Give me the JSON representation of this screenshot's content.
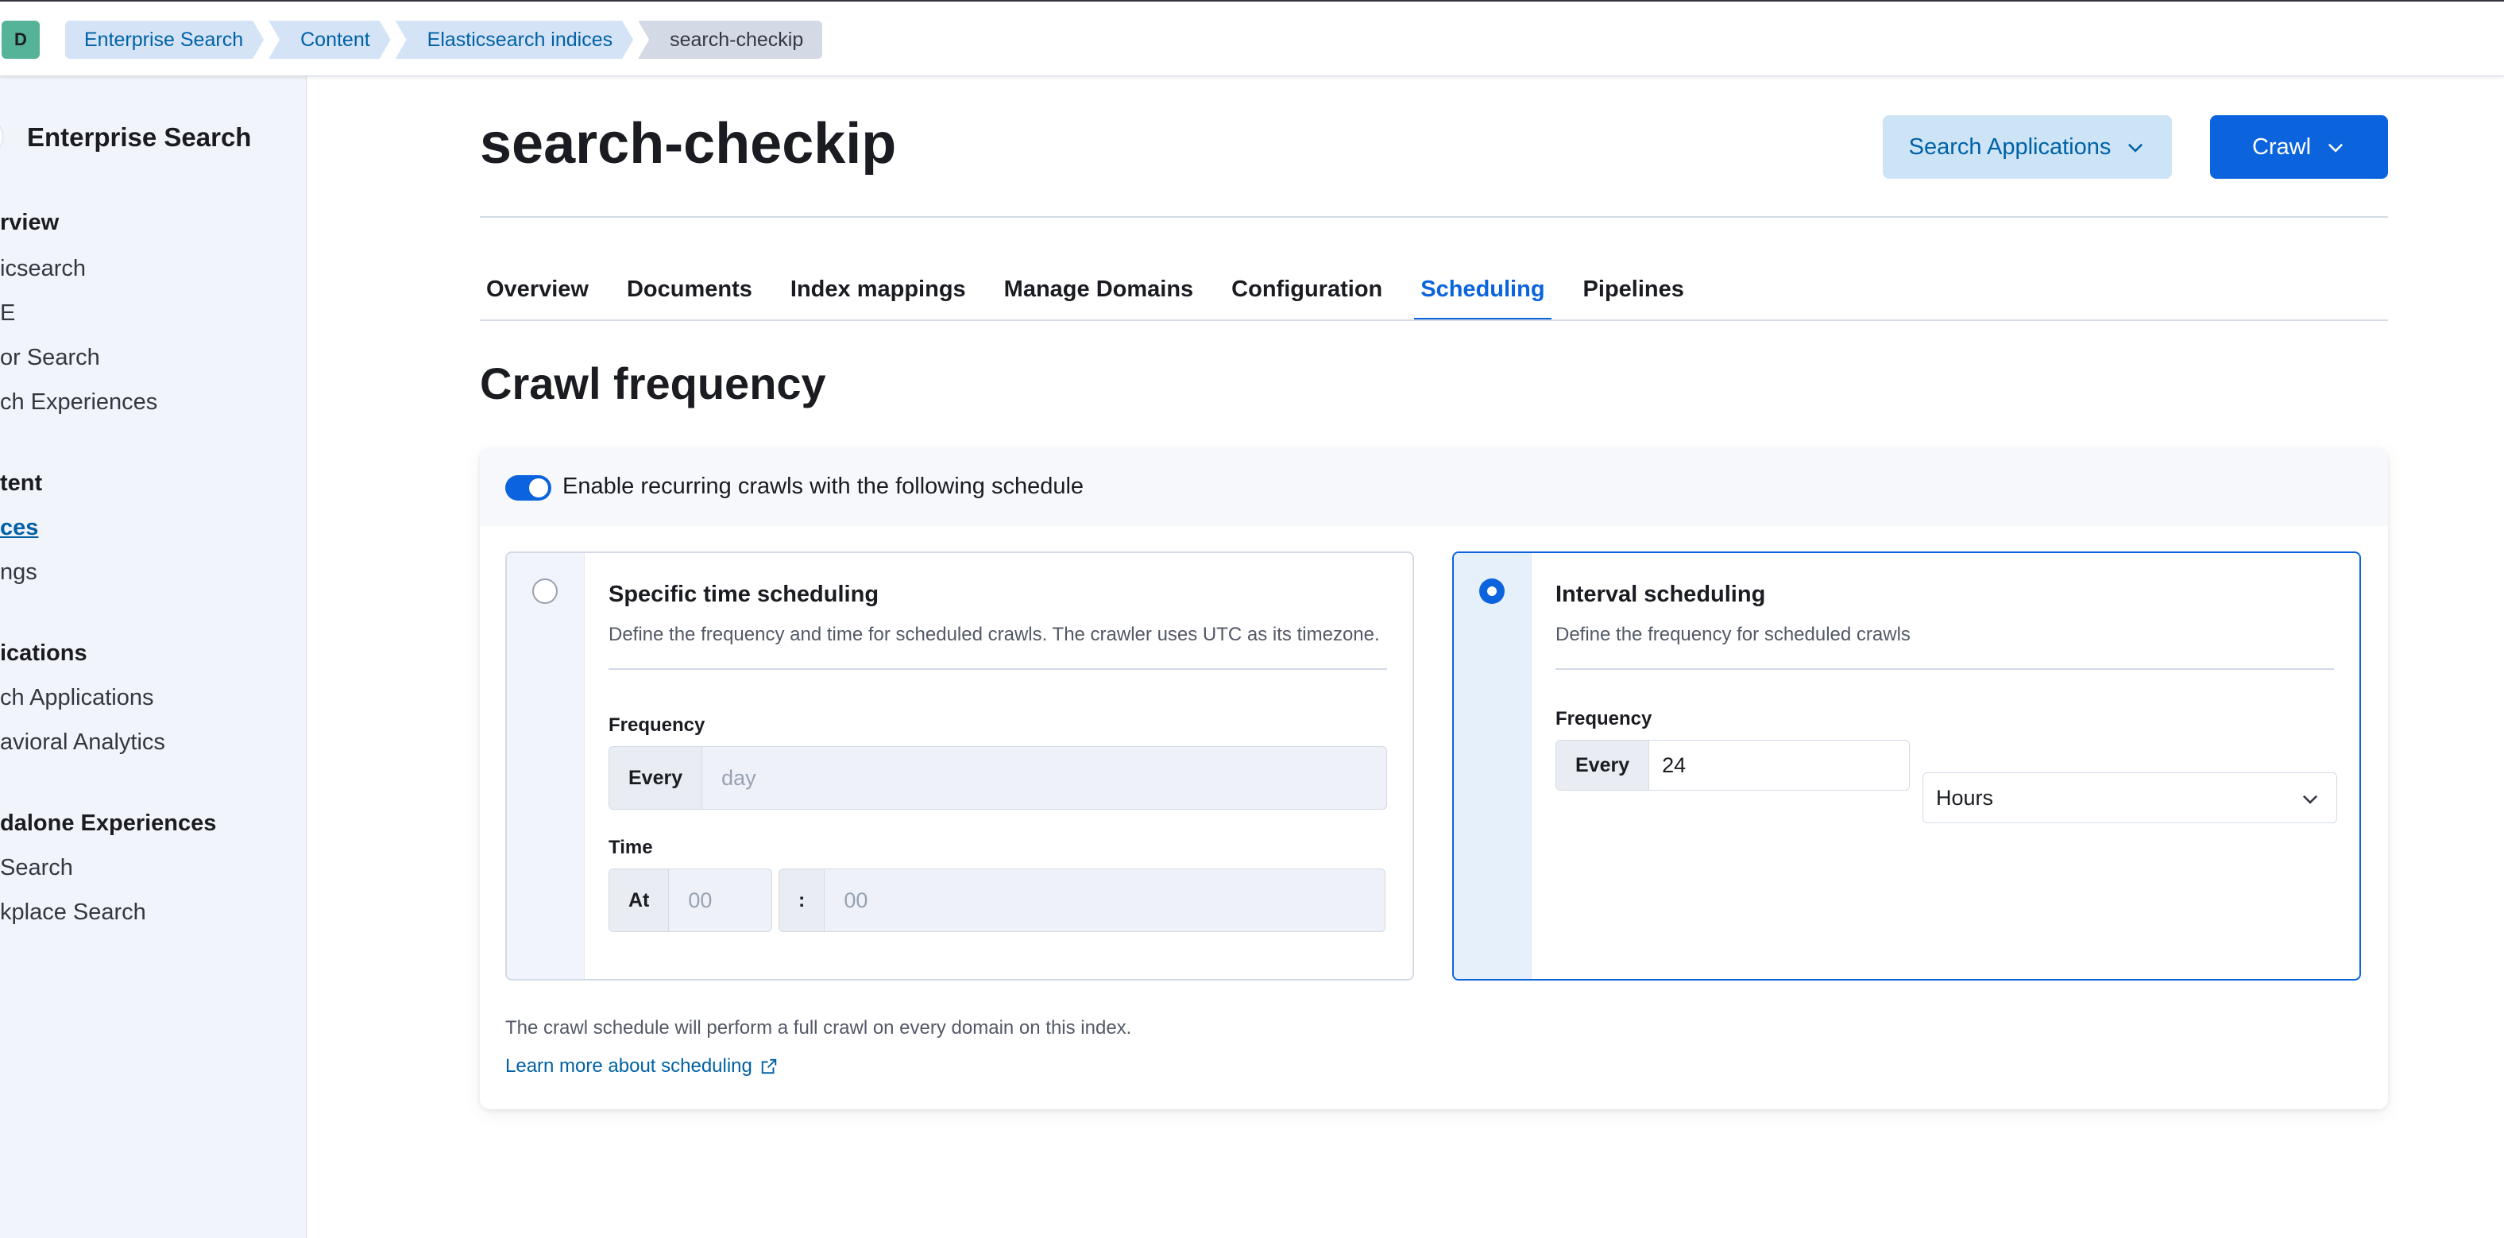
{
  "header": {
    "avatar_letter": "D",
    "breadcrumbs": [
      "Enterprise Search",
      "Content",
      "Elasticsearch indices",
      "search-checkip"
    ]
  },
  "sidebar": {
    "title": "Enterprise Search",
    "items": [
      {
        "label": "rview",
        "type": "heading"
      },
      {
        "label": "icsearch",
        "type": "item"
      },
      {
        "label": "E",
        "type": "item"
      },
      {
        "label": "or Search",
        "type": "item"
      },
      {
        "label": "ch Experiences",
        "type": "item"
      },
      {
        "label": "tent",
        "type": "heading"
      },
      {
        "label": "ces",
        "type": "active"
      },
      {
        "label": "ngs",
        "type": "item"
      },
      {
        "label": "ications",
        "type": "heading"
      },
      {
        "label": "ch Applications",
        "type": "item"
      },
      {
        "label": "avioral Analytics",
        "type": "item"
      },
      {
        "label": "dalone Experiences",
        "type": "heading"
      },
      {
        "label": "Search",
        "type": "item"
      },
      {
        "label": "kplace Search",
        "type": "item"
      }
    ]
  },
  "page": {
    "title": "search-checkip",
    "search_applications_label": "Search Applications",
    "crawl_label": "Crawl"
  },
  "tabs": [
    {
      "label": "Overview",
      "active": false
    },
    {
      "label": "Documents",
      "active": false
    },
    {
      "label": "Index mappings",
      "active": false
    },
    {
      "label": "Manage Domains",
      "active": false
    },
    {
      "label": "Configuration",
      "active": false
    },
    {
      "label": "Scheduling",
      "active": true
    },
    {
      "label": "Pipelines",
      "active": false
    }
  ],
  "crawl_frequency": {
    "title": "Crawl frequency",
    "toggle_label": "Enable recurring crawls with the following schedule",
    "toggle_on": true,
    "specific": {
      "title": "Specific time scheduling",
      "description": "Define the frequency and time for scheduled crawls. The crawler uses UTC as its timezone.",
      "frequency_label": "Frequency",
      "every_label": "Every",
      "frequency_placeholder": "day",
      "time_label": "Time",
      "at_label": "At",
      "hour_placeholder": "00",
      "separator": ":",
      "minute_placeholder": "00",
      "selected": false
    },
    "interval": {
      "title": "Interval scheduling",
      "description": "Define the frequency for scheduled crawls",
      "frequency_label": "Frequency",
      "every_label": "Every",
      "value": "24",
      "unit": "Hours",
      "selected": true
    },
    "footer_note": "The crawl schedule will perform a full crawl on every domain on this index.",
    "learn_more": "Learn more about scheduling"
  },
  "colors": {
    "accent": "#0b64dd",
    "link": "#0061a6",
    "sidebar_bg": "#f1f4fa",
    "avatar_bg": "#54b399"
  }
}
